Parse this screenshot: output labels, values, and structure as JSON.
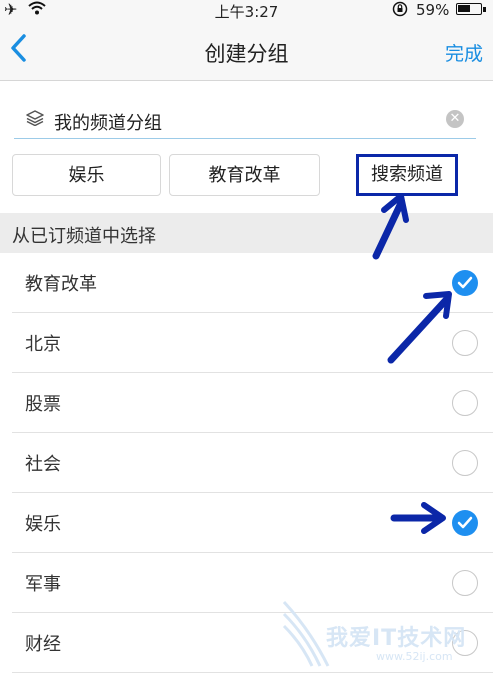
{
  "status_bar": {
    "time": "上午3:27",
    "battery_percent": "59%",
    "battery_level": 0.59
  },
  "nav": {
    "title": "创建分组",
    "done_label": "完成"
  },
  "group_name": {
    "value": "我的频道分组"
  },
  "chips": [
    {
      "label": "娱乐"
    },
    {
      "label": "教育改革"
    }
  ],
  "search_chip": {
    "label": "搜索频道"
  },
  "section": {
    "title": "从已订频道中选择"
  },
  "channels": [
    {
      "label": "教育改革",
      "checked": true
    },
    {
      "label": "北京",
      "checked": false
    },
    {
      "label": "股票",
      "checked": false
    },
    {
      "label": "社会",
      "checked": false
    },
    {
      "label": "娱乐",
      "checked": true
    },
    {
      "label": "军事",
      "checked": false
    },
    {
      "label": "财经",
      "checked": false
    }
  ],
  "watermark": {
    "text": "我爱IT技术网",
    "url": "www.52ij.com"
  },
  "colors": {
    "accent": "#1a8ee1",
    "check": "#1e8ff0",
    "annotation": "#0b27a8"
  }
}
